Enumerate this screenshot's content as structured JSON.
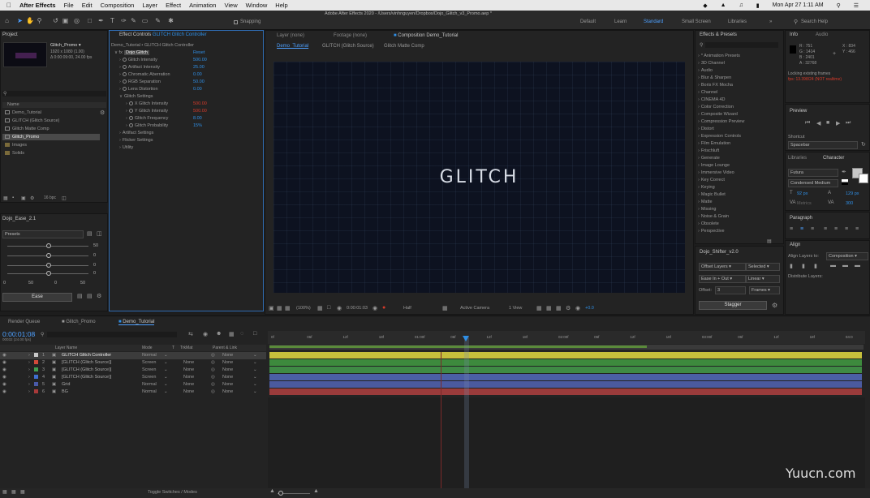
{
  "menubar": {
    "app": "After Effects",
    "items": [
      "File",
      "Edit",
      "Composition",
      "Layer",
      "Effect",
      "Animation",
      "View",
      "Window",
      "Help"
    ],
    "clock": "Mon Apr 27  1:11 AM"
  },
  "window_title": "Adobe After Effects 2020 - /Users/vinhnguyen/Dropbox/Dojo_Glitch_v3_Promo.aep *",
  "toolbar": {
    "snapping": "Snapping",
    "workspaces": [
      "Default",
      "Learn",
      "Standard",
      "Small Screen",
      "Libraries"
    ],
    "active_workspace": "Standard",
    "search_placeholder": "Search Help"
  },
  "project": {
    "title": "Project",
    "comp_name": "Glitch_Promo ▾",
    "comp_info_1": "1920 x 1080 (1.00)",
    "comp_info_2": "Δ 0:00:09:00, 24.00 fps",
    "col_name": "Name",
    "items": [
      "Demo_Tutorial",
      "GLITCH (Glitch Source)",
      "Glitch Matte Comp",
      "Glitch_Promo",
      "Images",
      "Solids"
    ],
    "bpc": "16 bpc"
  },
  "effect_controls": {
    "title": "Effect Controls",
    "layer": "GLITCH Glitch Controller",
    "path": "Demo_Tutorial • GLITCH Glitch Controller",
    "effect_name": "Dojo Glitch",
    "reset": "Reset",
    "props": [
      {
        "label": "Glitch Intensity",
        "value": "500.00"
      },
      {
        "label": "Artifact Intensity",
        "value": "25.00"
      },
      {
        "label": "Chromatic Aberration",
        "value": "0.00"
      },
      {
        "label": "RGB Separation",
        "value": "50.00"
      },
      {
        "label": "Lens Distortion",
        "value": "0.00"
      }
    ],
    "group": "Glitch Settings",
    "sub_props": [
      {
        "label": "X Glitch Intensity",
        "value": "500.00"
      },
      {
        "label": "Y Glitch Intensity",
        "value": "500.00"
      },
      {
        "label": "Glitch Frequency",
        "value": "8.00"
      },
      {
        "label": "Glitch Probability",
        "value": "15%"
      }
    ],
    "more_groups": [
      "Artifact Settings",
      "Flicker Settings",
      "Utility"
    ]
  },
  "dojo_ease": {
    "title": "Dojo_Ease_2.1",
    "presets": "Presets",
    "values": [
      "50",
      "0",
      "0",
      "0"
    ],
    "bottom_values": [
      "0",
      "50",
      "0",
      "50"
    ],
    "ease_button": "Ease"
  },
  "viewer": {
    "tabs": [
      "Layer (none)",
      "Footage (none)",
      "Composition Demo_Tutorial"
    ],
    "subtabs": [
      "Demo_Tutorial",
      "GLITCH (Glitch Source)",
      "Glitch Matte Comp"
    ],
    "comp_text": "GLITCH",
    "zoom": "(100%)",
    "timecode": "0:00:01:03",
    "resolution": "Half",
    "camera": "Active Camera",
    "view": "1 View",
    "exposure": "+0.0"
  },
  "effects_presets": {
    "title": "Effects & Presets",
    "items": [
      "* Animation Presets",
      "3D Channel",
      "Audio",
      "Blur & Sharpen",
      "Boris FX Mocha",
      "Channel",
      "CINEMA 4D",
      "Color Correction",
      "Composite Wizard",
      "Compression Preview",
      "Distort",
      "Expression Controls",
      "Film Emulation",
      "Frischluft",
      "Generate",
      "Image Lounge",
      "Immersive Video",
      "Key Correct",
      "Keying",
      "Magic Bullet",
      "Matte",
      "Missing",
      "Noise & Grain",
      "Obsolete",
      "Perspective"
    ]
  },
  "dojo_shifter": {
    "title": "Dojo_Shifter_v2.0",
    "offset_layers": "Offset Layers",
    "selected": "Selected",
    "ease": "Ease In + Out",
    "linear": "Linear",
    "offset_label": "Offset:",
    "offset_value": "3",
    "frames": "Frames",
    "stagger": "Stagger"
  },
  "info": {
    "tabs": [
      "Info",
      "Audio"
    ],
    "r": "R : 751",
    "g": "G : 1414",
    "b": "B : 2401",
    "a": "A : 32768",
    "x": "X : 834",
    "y": "Y : 466",
    "msg1": "Locking existing frames",
    "msg2": "fps: 13.398/24 (NOT realtime)"
  },
  "preview": {
    "title": "Preview",
    "shortcut_label": "Shortcut",
    "shortcut": "Spacebar"
  },
  "character": {
    "tabs": [
      "Libraries",
      "Character"
    ],
    "font": "Futura",
    "style": "Condensed Medium",
    "size": "92 px",
    "leading": "129 px",
    "kerning": "Metrics",
    "tracking": "300"
  },
  "paragraph": {
    "title": "Paragraph"
  },
  "align": {
    "title": "Align",
    "align_to_label": "Align Layers to:",
    "align_to": "Composition",
    "distribute": "Distribute Layers:"
  },
  "timeline": {
    "tabs": [
      "Render Queue",
      "Glitch_Promo",
      "Demo_Tutorial"
    ],
    "timecode": "0:00:01:08",
    "timecode_sub": "00032 (24.00 fps)",
    "col_layer": "Layer Name",
    "col_mode": "Mode",
    "col_t": "T",
    "col_trkmat": "TrkMat",
    "col_parent": "Parent & Link",
    "layers": [
      {
        "num": "1",
        "name": "GLITCH Glitch Controller",
        "mode": "Normal",
        "trk": "",
        "parent": "None",
        "color": "#c9c9c9"
      },
      {
        "num": "2",
        "name": "[GLITCH (Glitch Source)]",
        "mode": "Screen",
        "trk": "None",
        "parent": "None",
        "color": "#d04a3a"
      },
      {
        "num": "3",
        "name": "[GLITCH (Glitch Source)]",
        "mode": "Screen",
        "trk": "None",
        "parent": "None",
        "color": "#3fa04f"
      },
      {
        "num": "4",
        "name": "[GLITCH (Glitch Source)]",
        "mode": "Screen",
        "trk": "None",
        "parent": "None",
        "color": "#3f6fd0"
      },
      {
        "num": "5",
        "name": "Grid",
        "mode": "Normal",
        "trk": "None",
        "parent": "None",
        "color": "#4a5aa8"
      },
      {
        "num": "6",
        "name": "BG",
        "mode": "Normal",
        "trk": "None",
        "parent": "None",
        "color": "#a83a3a"
      }
    ],
    "bar_colors": [
      "#c6bf3c",
      "#3d8a3d",
      "#3f8a45",
      "#4b5fa6",
      "#4b5aa0",
      "#9a3b3b"
    ],
    "ruler_marks": [
      "0f",
      "06f",
      "12f",
      "18f",
      "01:00f",
      "06f",
      "12f",
      "18f",
      "02:00f",
      "06f",
      "12f",
      "18f",
      "03:00f",
      "06f",
      "12f",
      "18f",
      "04:0"
    ],
    "footer": "Toggle Switches / Modes"
  },
  "watermark": "Yuucn.com"
}
